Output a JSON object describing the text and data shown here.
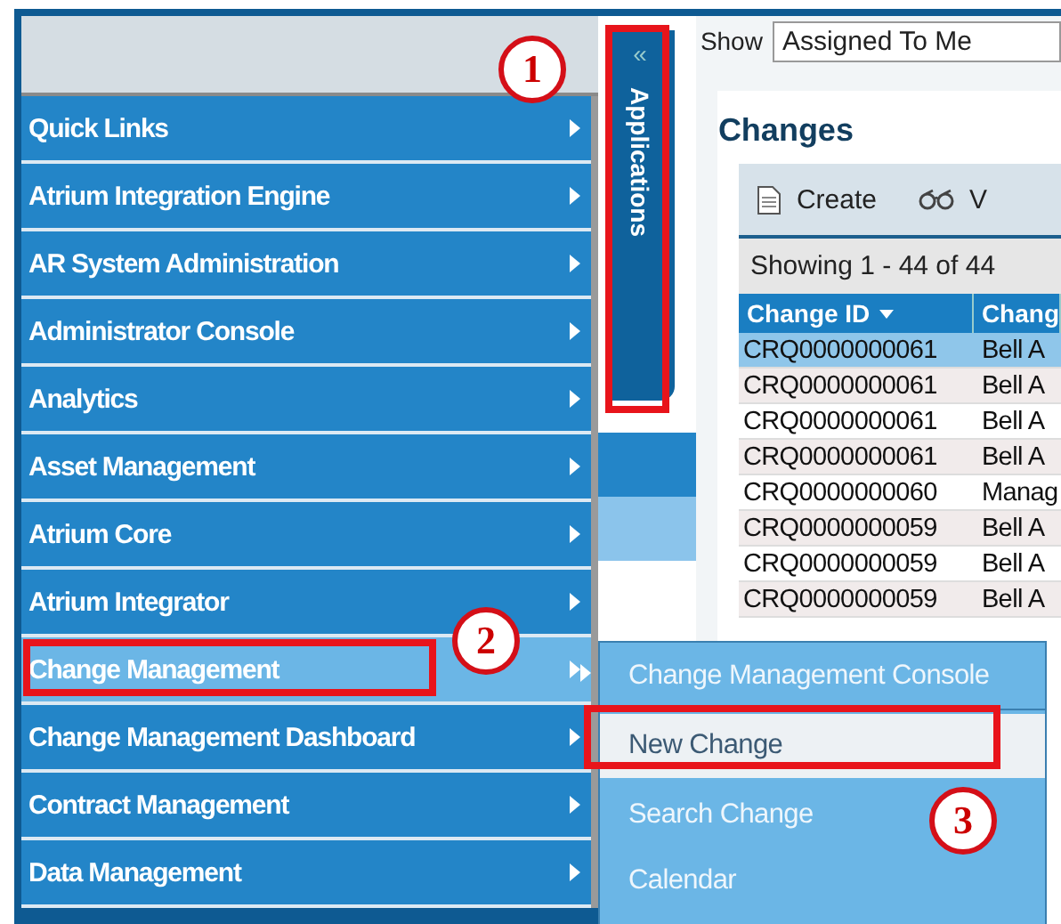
{
  "applications_tab": {
    "label": "Applications",
    "collapse_glyph": "«"
  },
  "menu": [
    {
      "label": "Quick Links",
      "selected": false
    },
    {
      "label": "Atrium Integration Engine",
      "selected": false
    },
    {
      "label": "AR System Administration",
      "selected": false
    },
    {
      "label": "Administrator Console",
      "selected": false
    },
    {
      "label": "Analytics",
      "selected": false
    },
    {
      "label": "Asset Management",
      "selected": false
    },
    {
      "label": "Atrium Core",
      "selected": false
    },
    {
      "label": "Atrium Integrator",
      "selected": false
    },
    {
      "label": "Change Management",
      "selected": true
    },
    {
      "label": "Change Management Dashboard",
      "selected": false
    },
    {
      "label": "Contract Management",
      "selected": false
    },
    {
      "label": "Data Management",
      "selected": false
    }
  ],
  "submenu": [
    {
      "label": "Change Management Console",
      "selected": false
    },
    {
      "label": "New Change",
      "selected": true
    },
    {
      "label": "Search Change",
      "selected": false
    },
    {
      "label": "Calendar",
      "selected": false
    }
  ],
  "filter": {
    "label": "Show",
    "value": "Assigned To Me"
  },
  "panel": {
    "title": "Changes",
    "toolbar": [
      {
        "label": "Create",
        "kind": "document"
      },
      {
        "label": "V",
        "kind": "glasses"
      }
    ],
    "count": "Showing 1 - 44 of 44"
  },
  "table": {
    "columns": [
      {
        "label": "Change ID",
        "sorted": true
      },
      {
        "label": "Chang",
        "sorted": false
      }
    ],
    "rows": [
      {
        "cells": [
          "CRQ0000000061",
          "Bell A"
        ],
        "selected": true
      },
      {
        "cells": [
          "CRQ0000000061",
          "Bell A"
        ],
        "selected": false
      },
      {
        "cells": [
          "CRQ0000000061",
          "Bell A"
        ],
        "selected": false
      },
      {
        "cells": [
          "CRQ0000000061",
          "Bell A"
        ],
        "selected": false
      },
      {
        "cells": [
          "CRQ0000000060",
          "Manag"
        ],
        "selected": false
      },
      {
        "cells": [
          "CRQ0000000059",
          "Bell A"
        ],
        "selected": false
      },
      {
        "cells": [
          "CRQ0000000059",
          "Bell A"
        ],
        "selected": false
      },
      {
        "cells": [
          "CRQ0000000059",
          "Bell A"
        ],
        "selected": false
      }
    ]
  },
  "annotations": [
    {
      "label": "1"
    },
    {
      "label": "2"
    },
    {
      "label": "3"
    }
  ]
}
